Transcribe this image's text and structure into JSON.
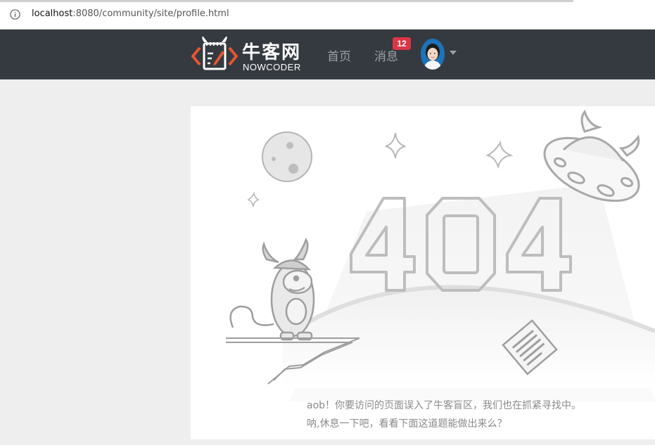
{
  "browser": {
    "url_host": "localhost",
    "url_rest": ":8080/community/site/profile.html",
    "info_icon": "info-icon"
  },
  "navbar": {
    "brand_cn": "牛客网",
    "brand_en": "NOWCODER",
    "home_label": "首页",
    "messages_label": "消息",
    "messages_badge": "12",
    "avatar_icon": "user-avatar",
    "dropdown_icon": "caret-down-icon",
    "colors": {
      "background": "#343a40",
      "badge": "#dc3545",
      "logo_accent": "#e8552f"
    }
  },
  "error_page": {
    "code": "404",
    "message_line1": "aob！你要访问的页面误入了牛客盲区，我们也在抓紧寻找中。",
    "message_line2": "呐,休息一下吧，看看下面这道题能做出来么？"
  }
}
